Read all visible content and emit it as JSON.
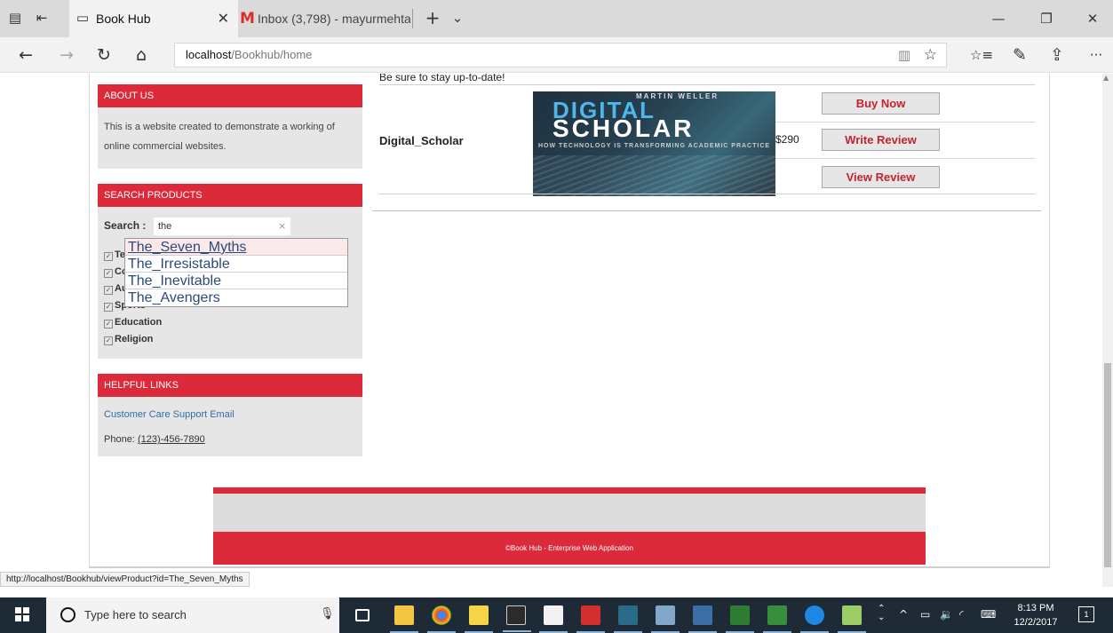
{
  "browser": {
    "tabs": [
      {
        "title": "Book Hub",
        "close": "✕",
        "active": true
      },
      {
        "icon_text": "M",
        "title": "Inbox (3,798) - mayurmehta",
        "active": false
      }
    ],
    "new_tab": "+",
    "tab_list": "⌄",
    "window_controls": {
      "minimize": "—",
      "maximize": "❐",
      "close": "✕"
    },
    "nav": {
      "back": "←",
      "forward": "→",
      "refresh": "↻",
      "home": "⌂"
    },
    "address": {
      "host": "localhost",
      "path": "/Bookhub/home"
    },
    "toolbar_right": {
      "favorites": "☆≡",
      "notes": "✎",
      "share": "⇪",
      "more": "···"
    },
    "icons": [
      "tab-preview-icon",
      "set-tabs-aside-icon",
      "reading-view-icon",
      "favorite-star-icon"
    ]
  },
  "sidebar": {
    "about": {
      "heading": "ABOUT US",
      "text": "This is a website created to demonstrate a working of online commercial websites."
    },
    "search": {
      "heading": "SEARCH PRODUCTS",
      "label": "Search :",
      "value": "the",
      "clear": "×",
      "categories": [
        {
          "label": "Te"
        },
        {
          "label": "Co"
        },
        {
          "label": "Au"
        },
        {
          "label": "Sports"
        },
        {
          "label": "Education"
        },
        {
          "label": "Religion"
        }
      ],
      "suggestions": [
        "The_Seven_Myths",
        "The_Irresistable",
        "The_Inevitable",
        "The_Avengers"
      ]
    },
    "helpful": {
      "heading": "HELPFUL LINKS",
      "email_link": "Customer Care Support Email",
      "phone_label": "Phone:",
      "phone_number": "(123)-456-7890"
    }
  },
  "main": {
    "tagline": "Be sure to stay up-to-date!",
    "product": {
      "name": "Digital_Scholar",
      "price": "$290",
      "cover": {
        "author": "MARTIN WELLER",
        "title_line1": "DIGITAL",
        "title_line2": "SCHOLAR",
        "subtitle": "HOW TECHNOLOGY IS TRANSFORMING ACADEMIC PRACTICE"
      },
      "buttons": {
        "buy": "Buy Now",
        "write": "Write Review",
        "view": "View Review"
      }
    }
  },
  "footer": {
    "text": "©Book Hub - Enterprise Web Application"
  },
  "status_url": "http://localhost/Bookhub/viewProduct?id=The_Seven_Myths",
  "taskbar": {
    "search_placeholder": "Type here to search",
    "time": "8:13 PM",
    "date": "12/2/2017",
    "notification_count": "1",
    "colors": {
      "bar": "#1e2a35",
      "accent_red": "#dc2a3a"
    }
  }
}
